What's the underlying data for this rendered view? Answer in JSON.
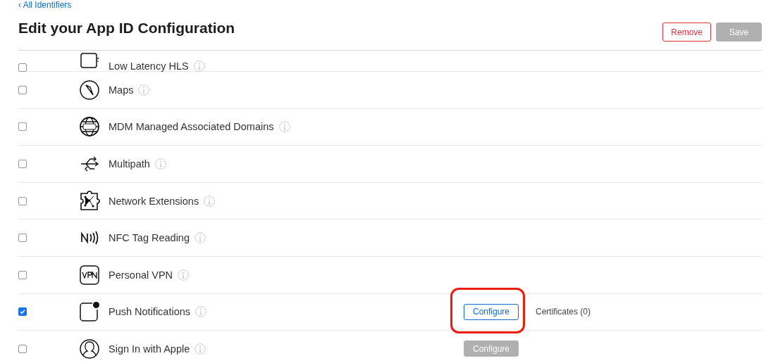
{
  "back_link": "‹ All Identifiers",
  "title": "Edit your App ID Configuration",
  "buttons": [
    {
      "label": "Remove",
      "kind": "danger",
      "disabled": false
    },
    {
      "label": "Save",
      "kind": "primary",
      "disabled": true
    }
  ],
  "capabilities": [
    {
      "label": "Low Latency HLS",
      "checked": false
    },
    {
      "label": "Maps",
      "checked": false
    },
    {
      "label": "MDM Managed Associated Domains",
      "checked": false
    },
    {
      "label": "Multipath",
      "checked": false
    },
    {
      "label": "Network Extensions",
      "checked": false
    },
    {
      "label": "NFC Tag Reading",
      "checked": false
    },
    {
      "label": "Personal VPN",
      "checked": false
    },
    {
      "label": "Push Notifications",
      "checked": true,
      "configure": {
        "label": "Configure",
        "disabled": false,
        "highlighted": true
      },
      "note": "Certificates (0)"
    },
    {
      "label": "Sign In with Apple",
      "checked": false,
      "configure": {
        "label": "Configure",
        "disabled": true,
        "highlighted": false
      }
    }
  ]
}
